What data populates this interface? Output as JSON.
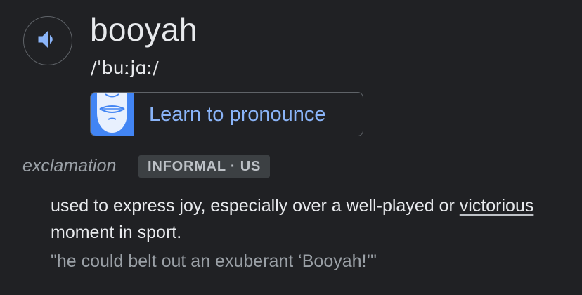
{
  "entry": {
    "headword": "booyah",
    "phonetic": "/ˈbuːjɑː/",
    "audio_icon": "speaker-icon",
    "pronounce": {
      "label": "Learn to pronounce",
      "icon": "mouth-icon"
    }
  },
  "sense": {
    "part_of_speech": "exclamation",
    "register_label": "INFORMAL · US",
    "definition_before": "used to express joy, especially over a well-played or ",
    "definition_link": "victorious",
    "definition_after": " moment in sport.",
    "example": "\"he could belt out an exuberant ‘Booyah!’\""
  },
  "colors": {
    "background": "#202124",
    "text": "#e8eaed",
    "muted": "#9aa0a6",
    "link": "#8ab4f8",
    "badge_bg": "#3c4043"
  }
}
